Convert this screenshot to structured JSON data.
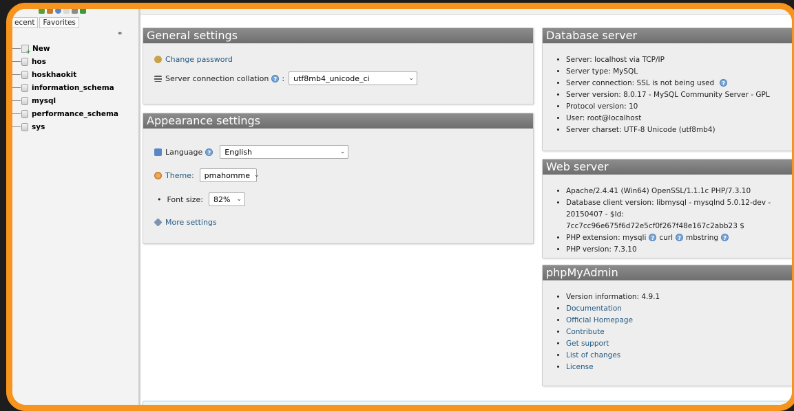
{
  "nav": {
    "tabs": [
      "ecent",
      "Favorites"
    ],
    "tree": [
      {
        "label": "New",
        "kind": "new"
      },
      {
        "label": "hos",
        "kind": "db"
      },
      {
        "label": "hoskhaokit",
        "kind": "db"
      },
      {
        "label": "information_schema",
        "kind": "db"
      },
      {
        "label": "mysql",
        "kind": "db"
      },
      {
        "label": "performance_schema",
        "kind": "db"
      },
      {
        "label": "sys",
        "kind": "db"
      }
    ]
  },
  "general": {
    "title": "General settings",
    "change_password": "Change password",
    "collation_label": "Server connection collation",
    "collation_value": "utf8mb4_unicode_ci"
  },
  "appearance": {
    "title": "Appearance settings",
    "language_label": "Language",
    "language_value": "English",
    "theme_label": "Theme:",
    "theme_value": "pmahomme",
    "fontsize_label": "Font size:",
    "fontsize_value": "82%",
    "more_settings": "More settings"
  },
  "db_server": {
    "title": "Database server",
    "items": [
      "Server: localhost via TCP/IP",
      "Server type: MySQL",
      "Server connection: SSL is not being used",
      "Server version: 8.0.17 - MySQL Community Server - GPL",
      "Protocol version: 10",
      "User: root@localhost",
      "Server charset: UTF-8 Unicode (utf8mb4)"
    ]
  },
  "web_server": {
    "title": "Web server",
    "apache": "Apache/2.4.41 (Win64) OpenSSL/1.1.1c PHP/7.3.10",
    "client_line1": "Database client version: libmysql - mysqlnd 5.0.12-dev -",
    "client_line2": "20150407 - $Id: 7cc7cc96e675f6d72e5cf0f267f48e167c2abb23 $",
    "php_ext_label": "PHP extension: mysqli",
    "php_ext_curl": "curl",
    "php_ext_mbstring": "mbstring",
    "php_version": "PHP version: 7.3.10"
  },
  "pma": {
    "title": "phpMyAdmin",
    "version": "Version information: 4.9.1",
    "links": [
      "Documentation",
      "Official Homepage",
      "Contribute",
      "Get support",
      "List of changes",
      "License"
    ]
  }
}
